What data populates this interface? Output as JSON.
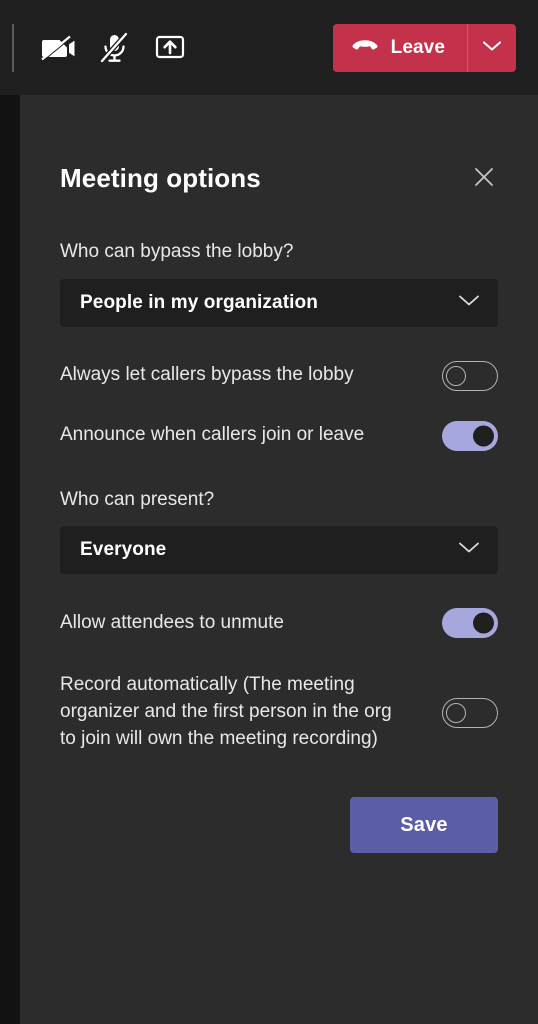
{
  "toolbar": {
    "camera_button": {
      "icon": "camera-off-icon",
      "label": "Turn camera on",
      "state": "off"
    },
    "mic_button": {
      "icon": "mic-off-icon",
      "label": "Unmute",
      "state": "off"
    },
    "share_button": {
      "icon": "share-screen-icon",
      "label": "Share content"
    },
    "leave_button": {
      "icon": "hangup-icon",
      "label": "Leave"
    },
    "leave_caret": {
      "icon": "chevron-down-icon",
      "label": "Leave options"
    }
  },
  "panel": {
    "title": "Meeting options",
    "close": {
      "icon": "close-icon",
      "label": "Close"
    },
    "bypass_lobby": {
      "label": "Who can bypass the lobby?",
      "value": "People in my organization",
      "caret_icon": "chevron-down-icon"
    },
    "always_bypass": {
      "label": "Always let callers bypass the lobby",
      "state": "off"
    },
    "announce_callers": {
      "label": "Announce when callers join or leave",
      "state": "on"
    },
    "who_can_present": {
      "label": "Who can present?",
      "value": "Everyone",
      "caret_icon": "chevron-down-icon"
    },
    "allow_unmute": {
      "label": "Allow attendees to unmute",
      "state": "on"
    },
    "record_automatically": {
      "label": "Record automatically (The meeting organizer and the first person in the org to join will own the meeting recording)",
      "state": "off"
    },
    "save_button": {
      "label": "Save"
    }
  },
  "colors": {
    "leave_red": "#c4314b",
    "accent_purple": "#a6a7dc",
    "save_purple": "#5b5ea6",
    "panel_bg": "#2d2c2c",
    "field_bg": "#1f1f1f"
  }
}
